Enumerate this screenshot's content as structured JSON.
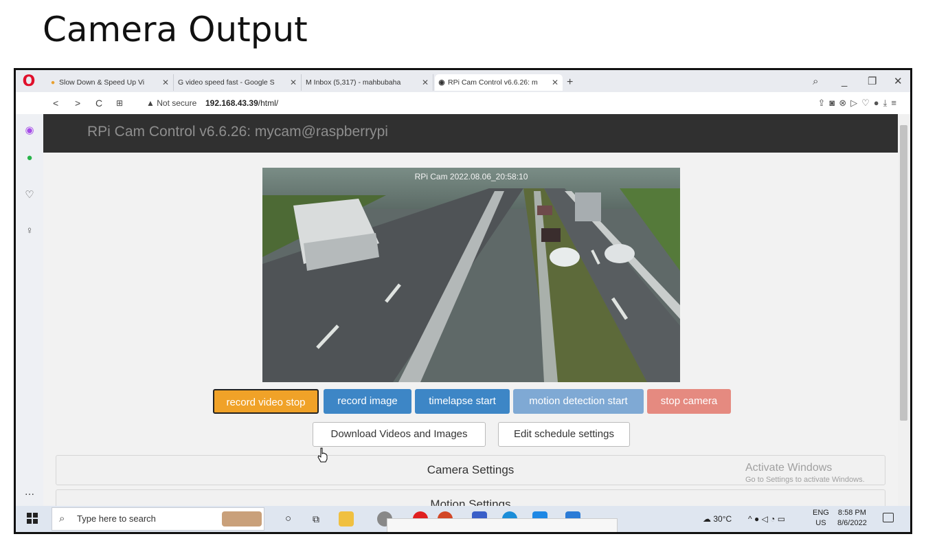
{
  "slide_title": "Camera Output",
  "browser": {
    "tabs": [
      {
        "label": "Slow Down & Speed Up Vi",
        "icon": "drops-icon"
      },
      {
        "label": "G video speed fast - Google S",
        "icon": "google-icon"
      },
      {
        "label": "M Inbox (5,317) - mahbubaha",
        "icon": "gmail-icon"
      },
      {
        "label": "RPi Cam Control v6.6.26: m",
        "icon": "globe-icon"
      }
    ],
    "new_tab": "+",
    "not_secure": "Not secure",
    "url": "192.168.43.39",
    "url_path": "/html/"
  },
  "page": {
    "header_title": "RPi Cam Control v6.6.26: mycam@raspberrypi",
    "camera_overlay": "RPi Cam  2022.08.06_20:58:10",
    "buttons": [
      {
        "label": "record video stop",
        "color": "#f0a228"
      },
      {
        "label": "record image",
        "color": "#3d86c6"
      },
      {
        "label": "timelapse start",
        "color": "#3d86c6"
      },
      {
        "label": "motion detection start",
        "color": "#7fa9d4"
      },
      {
        "label": "stop camera",
        "color": "#e58a80"
      }
    ],
    "buttons2": [
      {
        "label": "Download Videos and Images"
      },
      {
        "label": "Edit schedule settings"
      }
    ],
    "panels": [
      "Camera Settings",
      "Motion Settings"
    ],
    "activate_title": "Activate Windows",
    "activate_sub": "Go to Settings to activate Windows."
  },
  "taskbar": {
    "search_placeholder": "Type here to search",
    "weather": "30°C",
    "lang1": "ENG",
    "lang2": "US",
    "time": "8:58 PM",
    "date": "8/6/2022"
  }
}
